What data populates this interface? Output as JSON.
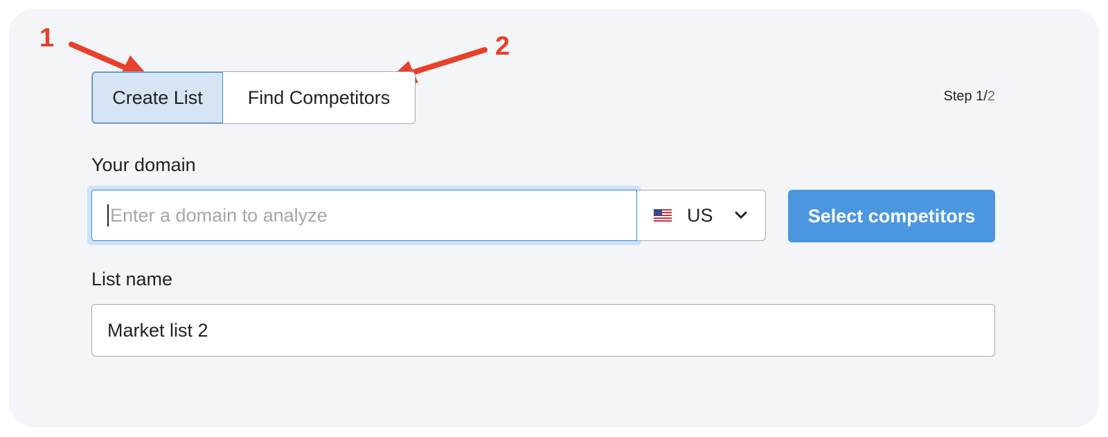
{
  "annotations": {
    "marker_1": "1",
    "marker_2": "2",
    "arrow_color": "#e8402a"
  },
  "tabs": [
    {
      "label": "Create List",
      "active": true
    },
    {
      "label": "Find Competitors",
      "active": false
    }
  ],
  "step": {
    "prefix": "Step 1/",
    "total": "2"
  },
  "domain": {
    "label": "Your domain",
    "placeholder": "Enter a domain to analyze",
    "value": "",
    "country": {
      "code": "US",
      "flag_icon": "us-flag-icon",
      "dropdown_icon": "chevron-down-icon"
    }
  },
  "actions": {
    "select_competitors_label": "Select competitors"
  },
  "list_name": {
    "label": "List name",
    "value": "Market list 2"
  },
  "colors": {
    "panel_bg": "#f4f5f8",
    "accent": "#2f8bdc",
    "primary_button": "#4a97e0",
    "active_tab_bg": "#d6e4f3"
  }
}
